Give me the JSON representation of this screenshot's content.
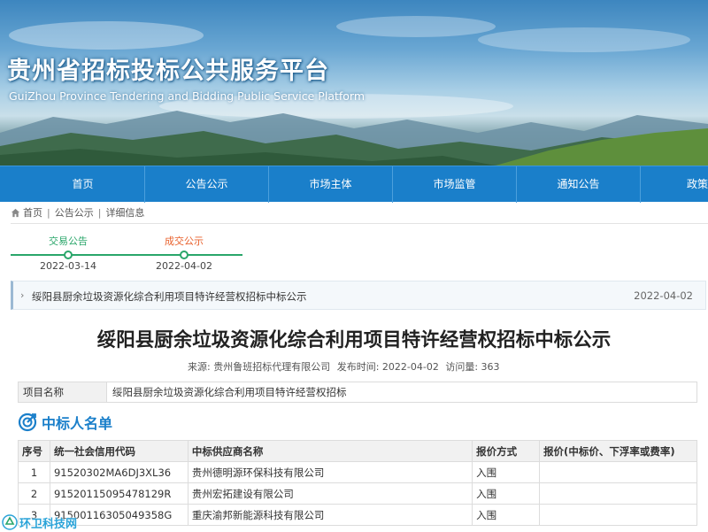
{
  "header": {
    "site_title": "贵州省招标投标公共服务平台",
    "site_subtitle": "GuiZhou Province Tendering and Bidding Public Service Platform"
  },
  "nav": {
    "items": [
      "首页",
      "公告公示",
      "市场主体",
      "市场监管",
      "通知公告",
      "政策法"
    ]
  },
  "breadcrumb": {
    "home": "首页",
    "level1": "公告公示",
    "level2": "详细信息",
    "separator": "|"
  },
  "timeline": {
    "steps": [
      {
        "label": "交易公告",
        "date": "2022-03-14",
        "color": "#2aa66a"
      },
      {
        "label": "成交公示",
        "date": "2022-04-02",
        "color": "#e8612c"
      }
    ]
  },
  "notice": {
    "title": "绥阳县厨余垃圾资源化综合利用项目特许经营权招标中标公示",
    "date": "2022-04-02"
  },
  "article": {
    "title": "绥阳县厨余垃圾资源化综合利用项目特许经营权招标中标公示",
    "source": "来源: 贵州鲁班招标代理有限公司",
    "publish_time": "发布时间: 2022-04-02",
    "visits": "访问量: 363"
  },
  "project": {
    "label": "项目名称",
    "value": "绥阳县厨余垃圾资源化综合利用项目特许经营权招标"
  },
  "section": {
    "title": "中标人名单"
  },
  "table": {
    "headers": [
      "序号",
      "统一社会信用代码",
      "中标供应商名称",
      "报价方式",
      "报价(中标价、下浮率或费率)"
    ],
    "rows": [
      [
        "1",
        "91520302MA6DJ3XL36",
        "贵州德明源环保科技有限公司",
        "入围",
        ""
      ],
      [
        "2",
        "915201150954781​29R",
        "贵州宏拓建设有限公司",
        "入围",
        ""
      ],
      [
        "3",
        "91500116305049358G",
        "重庆渝邦新能源科技有限公司",
        "入围",
        ""
      ]
    ]
  },
  "watermark": {
    "text": "环卫科技网"
  },
  "colors": {
    "nav_bg": "#1a7fca",
    "accent": "#1a7fca",
    "timeline_green": "#2aa66a",
    "timeline_orange": "#e8612c"
  }
}
